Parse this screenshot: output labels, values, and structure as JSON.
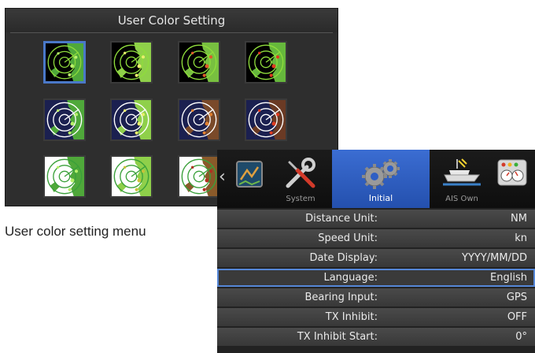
{
  "user_color_setting": {
    "title": "User Color Setting",
    "caption": "User color setting menu",
    "selected_index": 0,
    "rows": [
      {
        "background": "#000000",
        "ring": "#8fdc3c",
        "thumbs": [
          {
            "land": "#4fa83a",
            "echo": "#b7f06a"
          },
          {
            "land": "#8fd04a",
            "echo": "#e8ef6a"
          },
          {
            "land": "#78c040",
            "echo": "#e05a2a"
          },
          {
            "land": "#66b83c",
            "echo": "#e03a20"
          }
        ]
      },
      {
        "background": "#1b2050",
        "ring": "#ffffff",
        "thumbs": [
          {
            "land": "#4fa83a",
            "echo": "#b7f06a"
          },
          {
            "land": "#8fd04a",
            "echo": "#e8ef6a"
          },
          {
            "land": "#7a4a2a",
            "echo": "#e08030"
          },
          {
            "land": "#6a3a24",
            "echo": "#e03a20"
          }
        ]
      },
      {
        "background": "#ffffff",
        "ring": "#3aa03a",
        "thumbs": [
          {
            "land": "#4fa83a",
            "echo": "#b7f06a"
          },
          {
            "land": "#8fd04a",
            "echo": "#c8c23a"
          },
          {
            "land": "#8a5a2a",
            "echo": "#b03020"
          }
        ]
      }
    ]
  },
  "menu": {
    "tabs": [
      {
        "label": "",
        "icon": "chart-icon"
      },
      {
        "label": "System",
        "icon": "wrench-screwdriver-icon"
      },
      {
        "label": "Initial",
        "icon": "gears-icon",
        "active": true
      },
      {
        "label": "AIS Own",
        "icon": "ship-icon"
      },
      {
        "label": "",
        "icon": "gauges-icon"
      }
    ],
    "rows": [
      {
        "label": "Distance Unit:",
        "value": "NM"
      },
      {
        "label": "Speed Unit:",
        "value": "kn"
      },
      {
        "label": "Date Display:",
        "value": "YYYY/MM/DD"
      },
      {
        "label": "Language:",
        "value": "English",
        "selected": true
      },
      {
        "label": "Bearing Input:",
        "value": "GPS"
      },
      {
        "label": "TX Inhibit:",
        "value": "OFF"
      },
      {
        "label": "TX Inhibit Start:",
        "value": "0°"
      }
    ],
    "colors": {
      "active_tab": "#2f5fc4",
      "selection": "#5586d6"
    }
  }
}
